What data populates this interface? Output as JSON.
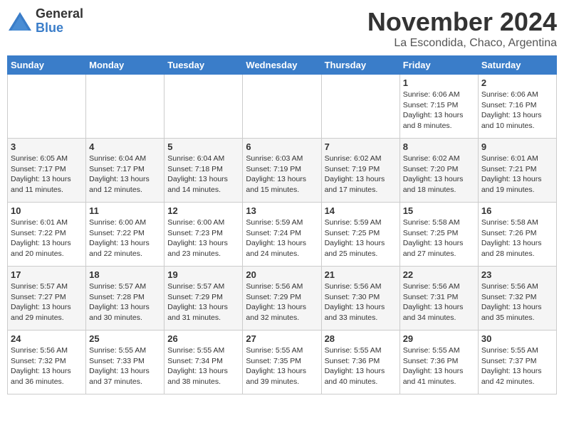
{
  "logo": {
    "general": "General",
    "blue": "Blue"
  },
  "title": "November 2024",
  "location": "La Escondida, Chaco, Argentina",
  "weekdays": [
    "Sunday",
    "Monday",
    "Tuesday",
    "Wednesday",
    "Thursday",
    "Friday",
    "Saturday"
  ],
  "weeks": [
    [
      {
        "day": "",
        "info": ""
      },
      {
        "day": "",
        "info": ""
      },
      {
        "day": "",
        "info": ""
      },
      {
        "day": "",
        "info": ""
      },
      {
        "day": "",
        "info": ""
      },
      {
        "day": "1",
        "info": "Sunrise: 6:06 AM\nSunset: 7:15 PM\nDaylight: 13 hours\nand 8 minutes."
      },
      {
        "day": "2",
        "info": "Sunrise: 6:06 AM\nSunset: 7:16 PM\nDaylight: 13 hours\nand 10 minutes."
      }
    ],
    [
      {
        "day": "3",
        "info": "Sunrise: 6:05 AM\nSunset: 7:17 PM\nDaylight: 13 hours\nand 11 minutes."
      },
      {
        "day": "4",
        "info": "Sunrise: 6:04 AM\nSunset: 7:17 PM\nDaylight: 13 hours\nand 12 minutes."
      },
      {
        "day": "5",
        "info": "Sunrise: 6:04 AM\nSunset: 7:18 PM\nDaylight: 13 hours\nand 14 minutes."
      },
      {
        "day": "6",
        "info": "Sunrise: 6:03 AM\nSunset: 7:19 PM\nDaylight: 13 hours\nand 15 minutes."
      },
      {
        "day": "7",
        "info": "Sunrise: 6:02 AM\nSunset: 7:19 PM\nDaylight: 13 hours\nand 17 minutes."
      },
      {
        "day": "8",
        "info": "Sunrise: 6:02 AM\nSunset: 7:20 PM\nDaylight: 13 hours\nand 18 minutes."
      },
      {
        "day": "9",
        "info": "Sunrise: 6:01 AM\nSunset: 7:21 PM\nDaylight: 13 hours\nand 19 minutes."
      }
    ],
    [
      {
        "day": "10",
        "info": "Sunrise: 6:01 AM\nSunset: 7:22 PM\nDaylight: 13 hours\nand 20 minutes."
      },
      {
        "day": "11",
        "info": "Sunrise: 6:00 AM\nSunset: 7:22 PM\nDaylight: 13 hours\nand 22 minutes."
      },
      {
        "day": "12",
        "info": "Sunrise: 6:00 AM\nSunset: 7:23 PM\nDaylight: 13 hours\nand 23 minutes."
      },
      {
        "day": "13",
        "info": "Sunrise: 5:59 AM\nSunset: 7:24 PM\nDaylight: 13 hours\nand 24 minutes."
      },
      {
        "day": "14",
        "info": "Sunrise: 5:59 AM\nSunset: 7:25 PM\nDaylight: 13 hours\nand 25 minutes."
      },
      {
        "day": "15",
        "info": "Sunrise: 5:58 AM\nSunset: 7:25 PM\nDaylight: 13 hours\nand 27 minutes."
      },
      {
        "day": "16",
        "info": "Sunrise: 5:58 AM\nSunset: 7:26 PM\nDaylight: 13 hours\nand 28 minutes."
      }
    ],
    [
      {
        "day": "17",
        "info": "Sunrise: 5:57 AM\nSunset: 7:27 PM\nDaylight: 13 hours\nand 29 minutes."
      },
      {
        "day": "18",
        "info": "Sunrise: 5:57 AM\nSunset: 7:28 PM\nDaylight: 13 hours\nand 30 minutes."
      },
      {
        "day": "19",
        "info": "Sunrise: 5:57 AM\nSunset: 7:29 PM\nDaylight: 13 hours\nand 31 minutes."
      },
      {
        "day": "20",
        "info": "Sunrise: 5:56 AM\nSunset: 7:29 PM\nDaylight: 13 hours\nand 32 minutes."
      },
      {
        "day": "21",
        "info": "Sunrise: 5:56 AM\nSunset: 7:30 PM\nDaylight: 13 hours\nand 33 minutes."
      },
      {
        "day": "22",
        "info": "Sunrise: 5:56 AM\nSunset: 7:31 PM\nDaylight: 13 hours\nand 34 minutes."
      },
      {
        "day": "23",
        "info": "Sunrise: 5:56 AM\nSunset: 7:32 PM\nDaylight: 13 hours\nand 35 minutes."
      }
    ],
    [
      {
        "day": "24",
        "info": "Sunrise: 5:56 AM\nSunset: 7:32 PM\nDaylight: 13 hours\nand 36 minutes."
      },
      {
        "day": "25",
        "info": "Sunrise: 5:55 AM\nSunset: 7:33 PM\nDaylight: 13 hours\nand 37 minutes."
      },
      {
        "day": "26",
        "info": "Sunrise: 5:55 AM\nSunset: 7:34 PM\nDaylight: 13 hours\nand 38 minutes."
      },
      {
        "day": "27",
        "info": "Sunrise: 5:55 AM\nSunset: 7:35 PM\nDaylight: 13 hours\nand 39 minutes."
      },
      {
        "day": "28",
        "info": "Sunrise: 5:55 AM\nSunset: 7:36 PM\nDaylight: 13 hours\nand 40 minutes."
      },
      {
        "day": "29",
        "info": "Sunrise: 5:55 AM\nSunset: 7:36 PM\nDaylight: 13 hours\nand 41 minutes."
      },
      {
        "day": "30",
        "info": "Sunrise: 5:55 AM\nSunset: 7:37 PM\nDaylight: 13 hours\nand 42 minutes."
      }
    ]
  ]
}
